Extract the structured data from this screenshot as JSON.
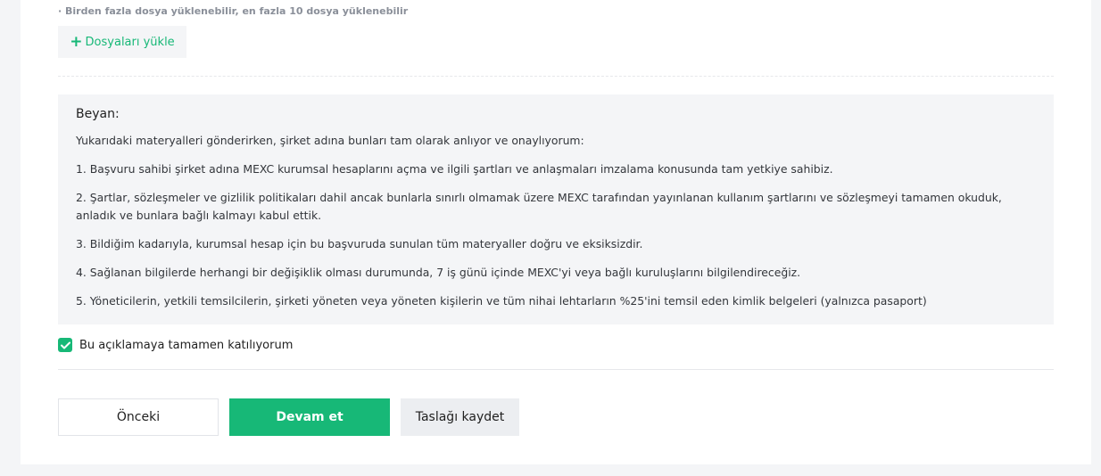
{
  "upload": {
    "hint": "· Birden fazla dosya yüklenebilir, en fazla 10 dosya yüklenebilir",
    "button_label": "Dosyaları yükle"
  },
  "declaration": {
    "title": "Beyan:",
    "intro": "Yukarıdaki materyalleri gönderirken, şirket adına bunları tam olarak anlıyor ve onaylıyorum:",
    "items": [
      "1. Başvuru sahibi şirket adına MEXC kurumsal hesaplarını açma ve ilgili şartları ve anlaşmaları imzalama konusunda tam yetkiye sahibiz.",
      "2. Şartlar, sözleşmeler ve gizlilik politikaları dahil ancak bunlarla sınırlı olmamak üzere MEXC tarafından yayınlanan kullanım şartlarını ve sözleşmeyi tamamen okuduk, anladık ve bunlara bağlı kalmayı kabul ettik.",
      "3. Bildiğim kadarıyla, kurumsal hesap için bu başvuruda sunulan tüm materyaller doğru ve eksiksizdir.",
      "4. Sağlanan bilgilerde herhangi bir değişiklik olması durumunda, 7 iş günü içinde MEXC'yi veya bağlı kuruluşlarını bilgilendireceğiz.",
      "5. Yöneticilerin, yetkili temsilcilerin, şirketi yöneten veya yöneten kişilerin ve tüm nihai lehtarların %25'ini temsil eden kimlik belgeleri (yalnızca pasaport)"
    ]
  },
  "agreement": {
    "checked": true,
    "label": "Bu açıklamaya tamamen katılıyorum"
  },
  "actions": {
    "prev_label": "Önceki",
    "next_label": "Devam et",
    "draft_label": "Taslağı kaydet"
  },
  "colors": {
    "accent": "#17b877",
    "panel_bg": "#f4f5f7"
  },
  "icons": {
    "upload": "plus-icon",
    "checkbox": "check-icon"
  }
}
